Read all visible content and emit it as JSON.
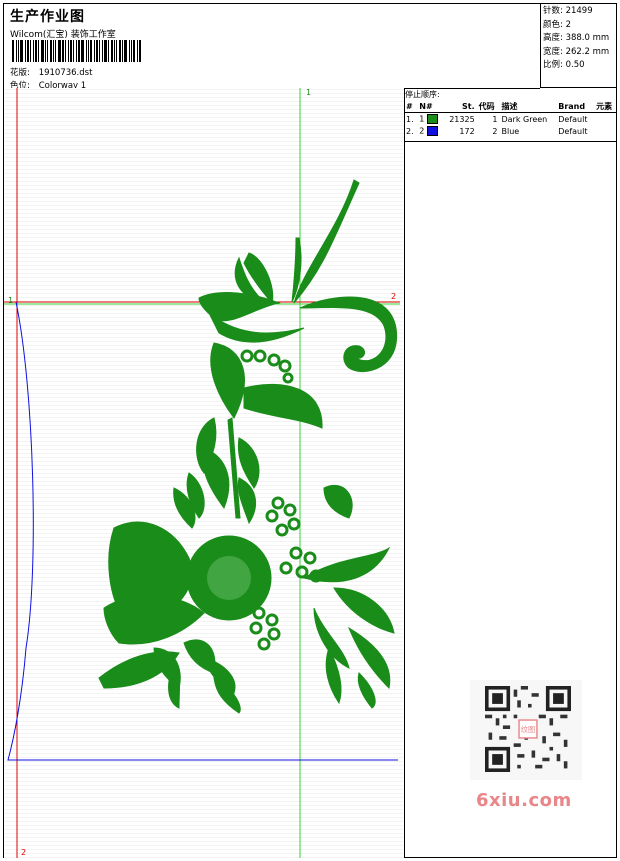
{
  "header": {
    "title": "生产作业图",
    "studio": "Wilcom(汇宝) 装饰工作室",
    "design_label": "花版:",
    "design_value": "1910736.dst",
    "colorway_label": "色位:",
    "colorway_value": "Colorway 1"
  },
  "stats": [
    {
      "label": "针数:",
      "value": "21499"
    },
    {
      "label": "颜色:",
      "value": "2"
    },
    {
      "label": "高度:",
      "value": "388.0 mm"
    },
    {
      "label": "宽度:",
      "value": "262.2 mm"
    },
    {
      "label": "比例:",
      "value": "0.50"
    }
  ],
  "stop_sequence": {
    "title": "停止顺序:",
    "columns": [
      "#",
      "N#",
      "St.",
      "代码",
      "描述",
      "Brand",
      "元素"
    ],
    "rows": [
      {
        "index": "1.",
        "n": "1",
        "color": "#1a8c1a",
        "stitches": "21325",
        "code": "1",
        "desc": "Dark Green",
        "brand": "Default"
      },
      {
        "index": "2.",
        "n": "2",
        "color": "#1010e0",
        "stitches": "172",
        "code": "2",
        "desc": "Blue",
        "brand": "Default"
      }
    ]
  },
  "canvas": {
    "markers": {
      "top_green": "1",
      "left_mark": "1",
      "right_mark": "2",
      "bottom_red": "2"
    }
  },
  "watermark": {
    "text": "6xiu.com",
    "stamp": "纹图"
  },
  "colors": {
    "thread_green": "#1a8c1a",
    "thread_blue": "#1010e0",
    "guide_red": "#e00000",
    "guide_green": "#3ad23a"
  }
}
